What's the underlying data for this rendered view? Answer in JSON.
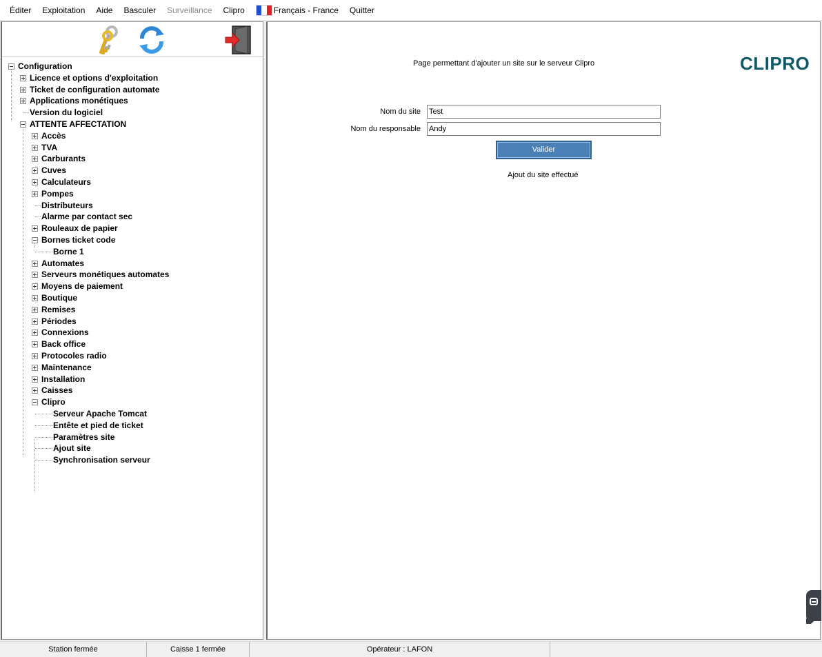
{
  "menu": {
    "items": [
      "Éditer",
      "Exploitation",
      "Aide",
      "Basculer",
      "Surveillance",
      "Clipro"
    ],
    "language": "Français - France",
    "quit": "Quitter",
    "flag_colors": [
      "#1f4fcf",
      "#ffffff",
      "#e31f26"
    ]
  },
  "toolbar": {
    "icons": [
      "keys-icon",
      "refresh-icon",
      "exit-door-icon"
    ]
  },
  "tree": {
    "root": "Configuration",
    "level1": [
      "Licence et options d'exploitation",
      "Ticket de configuration automate",
      "Applications monétiques",
      "Version du logiciel",
      "ATTENTE AFFECTATION"
    ],
    "attente_children": [
      "Accès",
      "TVA",
      "Carburants",
      "Cuves",
      "Calculateurs",
      "Pompes",
      "Distributeurs",
      "Alarme par contact sec",
      "Rouleaux de papier",
      "Bornes ticket code",
      "Automates",
      "Serveurs monétiques automates",
      "Moyens de paiement",
      "Boutique",
      "Remises",
      "Périodes",
      "Connexions",
      "Back office",
      "Protocoles radio",
      "Maintenance",
      "Installation",
      "Caisses",
      "Clipro"
    ],
    "bornes_children": [
      "Borne 1"
    ],
    "clipro_children": [
      "Serveur Apache Tomcat",
      "Entête et pied de ticket",
      "Paramètres site",
      "Ajout site",
      "Synchronisation serveur"
    ]
  },
  "main": {
    "description": "Page permettant d'ajouter un site sur le serveur Clipro",
    "logo_text": "CLIPRO",
    "logo_color": "#0e5868",
    "site_label": "Nom du site",
    "site_value": "Test",
    "responsable_label": "Nom du responsable",
    "responsable_value": "Andy",
    "submit_label": "Valider",
    "submit_color": "#4a80b6",
    "status_message": "Ajout du site effectué"
  },
  "statusbar": {
    "station": "Station fermée",
    "caisse": "Caisse 1 fermée",
    "operateur": "Opérateur : LAFON"
  }
}
